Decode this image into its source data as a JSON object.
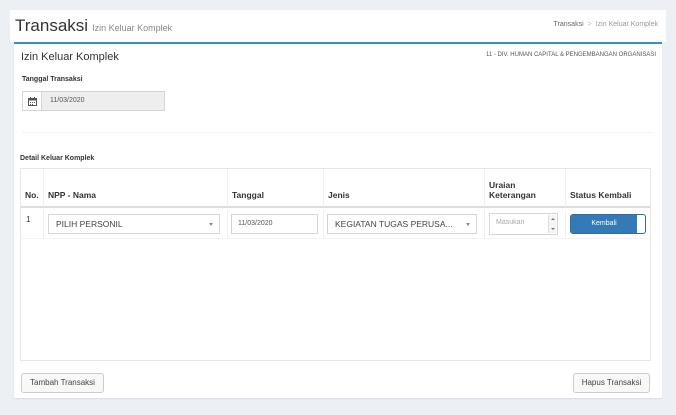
{
  "header": {
    "title": "Transaksi",
    "subtitle": "Izin Keluar Komplek",
    "breadcrumb": [
      "Transaksi",
      "Izin Keluar Komplek"
    ]
  },
  "box": {
    "title": "Izin Keluar Komplek",
    "org": "11 - DIV. HUMAN CAPITAL & PENGEMBANGAN ORGANISASI"
  },
  "form": {
    "tanggal_label": "Tanggal Transaksi",
    "tanggal_value": "11/03/2020",
    "icon": "calendar-icon"
  },
  "detail": {
    "label": "Detail Keluar Komplek",
    "columns": [
      "No.",
      "NPP - Nama",
      "Tanggal",
      "Jenis",
      "Uraian Keterangan",
      "Status Kembali"
    ],
    "rows": [
      {
        "no": "1",
        "personil": "PILIH PERSONIL",
        "tanggal": "11/03/2020",
        "jenis": "KEGIATAN TUGAS PERUSA...",
        "uraian_placeholder": "Masukan",
        "status": "Kembali"
      }
    ]
  },
  "actions": {
    "tambah": "Tambah Transaksi",
    "hapus": "Hapus Transaksi"
  },
  "colors": {
    "accent": "#3c8dbc",
    "toggle_on": "#337ab7",
    "background": "#ecf0f5"
  }
}
